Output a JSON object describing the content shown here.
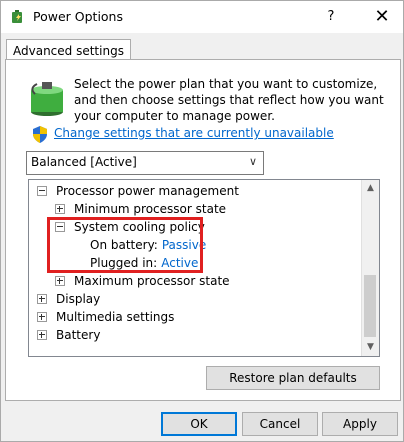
{
  "window": {
    "title": "Power Options",
    "help_label": "?",
    "close_label": "✕"
  },
  "tab": {
    "label": "Advanced settings"
  },
  "description": "Select the power plan that you want to customize, and then choose settings that reflect how you want your computer to manage power.",
  "change_settings_link": "Change settings that are currently unavailable",
  "plan_dropdown": {
    "selected": "Balanced [Active]"
  },
  "tree": {
    "processor_power_management": "Processor power management",
    "minimum_processor_state": "Minimum processor state",
    "system_cooling_policy": "System cooling policy",
    "on_battery_label": "On battery:",
    "on_battery_value": "Passive",
    "plugged_in_label": "Plugged in:",
    "plugged_in_value": "Active",
    "maximum_processor_state": "Maximum processor state",
    "display": "Display",
    "multimedia_settings": "Multimedia settings",
    "battery": "Battery"
  },
  "buttons": {
    "restore": "Restore plan defaults",
    "ok": "OK",
    "cancel": "Cancel",
    "apply": "Apply"
  },
  "colors": {
    "link": "#0066cc",
    "highlight": "#e02020",
    "default_button_border": "#0078d7"
  }
}
